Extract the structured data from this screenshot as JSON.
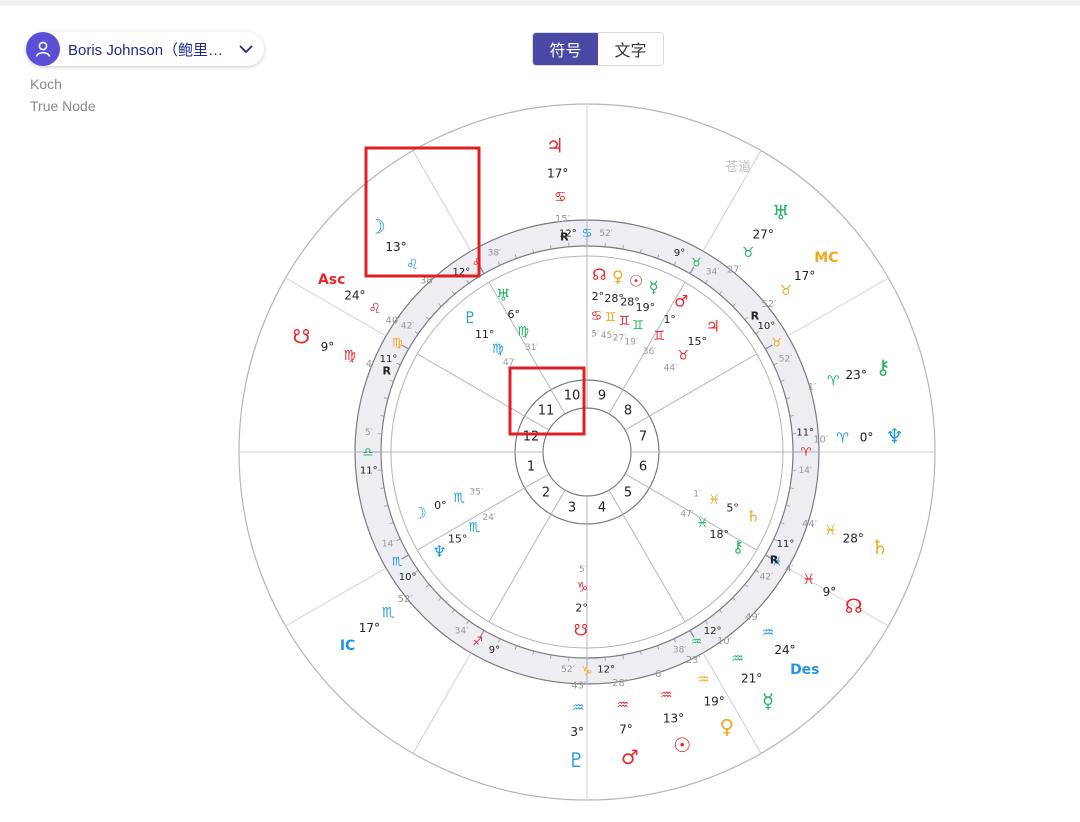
{
  "profile": {
    "name": "Boris Johnson（鲍里…",
    "house_system": "Koch",
    "node_type": "True Node"
  },
  "view_toggle": {
    "symbol_label": "符号",
    "text_label": "文字",
    "active": "symbol"
  },
  "colors": {
    "fire": "#e8272b",
    "earth": "#f0a81c",
    "air": "#21b45a",
    "water": "#2196e6",
    "accent": "#4a4aa6",
    "highlight": "#e02020",
    "ring": "#ededf2",
    "line": "#b4b4bc"
  },
  "chart_data": {
    "type": "astrology-chart",
    "zodiac_labels": {
      "text": "苍道",
      "color": "#c0c0c8"
    },
    "angles": [
      {
        "name": "Asc",
        "color": "#e8272b"
      },
      {
        "name": "MC",
        "color": "#f0a81c"
      },
      {
        "name": "Des",
        "color": "#2196e6"
      },
      {
        "name": "IC",
        "color": "#2196e6"
      }
    ],
    "house_numbers": [
      "1",
      "2",
      "3",
      "4",
      "5",
      "6",
      "7",
      "8",
      "9",
      "10",
      "11",
      "12"
    ],
    "cusps": [
      {
        "deg": "12°",
        "sign": "♋",
        "min": "52′",
        "color": "#2196e6"
      },
      {
        "deg": "9°",
        "sign": "♉",
        "min": "34′",
        "color": "#21b45a"
      },
      {
        "deg": "10°",
        "sign": "♉",
        "min": "52′",
        "color": "#f0a81c"
      },
      {
        "deg": "11°",
        "sign": "♈",
        "min": "14′",
        "color": "#e8272b"
      },
      {
        "deg": "11°",
        "sign": "♓",
        "min": "42′",
        "color": "#2196e6"
      },
      {
        "deg": "12°",
        "sign": "♒",
        "min": "38′",
        "color": "#21b45a"
      },
      {
        "deg": "12°",
        "sign": "♑",
        "min": "52′",
        "color": "#f0a81c"
      },
      {
        "deg": "9°",
        "sign": "♐",
        "min": "34′",
        "color": "#e8272b"
      },
      {
        "deg": "10°",
        "sign": "♏",
        "min": "14′",
        "color": "#2196e6"
      },
      {
        "deg": "11°",
        "sign": "♎",
        "min": "5′",
        "color": "#21b45a"
      },
      {
        "deg": "11°",
        "sign": "♍",
        "min": "42′",
        "color": "#f0a81c"
      },
      {
        "deg": "12°",
        "sign": "♌",
        "min": "38′",
        "color": "#e8272b"
      }
    ],
    "outer_planets": [
      {
        "glyph": "♃",
        "deg": "17°",
        "sign": "♋",
        "min": "15′",
        "retro": "R",
        "color": "#e8272b"
      },
      {
        "glyph": "☽",
        "deg": "13°",
        "sign": "♌",
        "min": "38′",
        "retro": "",
        "color": "#2196e6"
      },
      {
        "glyph": "Asc",
        "deg": "24°",
        "sign": "♌",
        "min": "40′",
        "retro": "",
        "color": "#e8272b"
      },
      {
        "glyph": "☋",
        "deg": "9°",
        "sign": "♍",
        "min": "4′",
        "retro": "R",
        "color": "#e8272b"
      },
      {
        "glyph": "♅",
        "deg": "27°",
        "sign": "♉",
        "min": "27′",
        "retro": "",
        "color": "#21b45a"
      },
      {
        "glyph": "MC",
        "deg": "17°",
        "sign": "♉",
        "min": "52′",
        "retro": "R",
        "color": "#f0a81c"
      },
      {
        "glyph": "⚷",
        "deg": "23°",
        "sign": "♈",
        "min": "1′",
        "retro": "",
        "color": "#21b45a"
      },
      {
        "glyph": "♆",
        "deg": "0°",
        "sign": "♈",
        "min": "10′",
        "retro": "",
        "color": "#2196e6"
      },
      {
        "glyph": "♄",
        "deg": "28°",
        "sign": "♓",
        "min": "44′",
        "retro": "",
        "color": "#f0a81c"
      },
      {
        "glyph": "☊",
        "deg": "9°",
        "sign": "♓",
        "min": "4′",
        "retro": "R",
        "color": "#e8272b"
      },
      {
        "glyph": "Des",
        "deg": "24°",
        "sign": "♒",
        "min": "49′",
        "retro": "",
        "color": "#2196e6"
      },
      {
        "glyph": "☿",
        "deg": "21°",
        "sign": "♒",
        "min": "10′",
        "retro": "",
        "color": "#21b45a"
      },
      {
        "glyph": "♀",
        "deg": "19°",
        "sign": "♒",
        "min": "23′",
        "retro": "",
        "color": "#f0a81c"
      },
      {
        "glyph": "☉",
        "deg": "13°",
        "sign": "♒",
        "min": "6′",
        "retro": "",
        "color": "#e8272b"
      },
      {
        "glyph": "♂",
        "deg": "7°",
        "sign": "♒",
        "min": "28′",
        "retro": "",
        "color": "#e8272b"
      },
      {
        "glyph": "♇",
        "deg": "3°",
        "sign": "♒",
        "min": "43′",
        "retro": "",
        "color": "#2196e6"
      },
      {
        "glyph": "IC",
        "deg": "17°",
        "sign": "♏",
        "min": "52′",
        "retro": "",
        "color": "#2196e6"
      }
    ],
    "inner_planets": [
      {
        "glyph": "☊",
        "deg": "2°",
        "sign": "♋",
        "min": "5′",
        "color": "#e8272b"
      },
      {
        "glyph": "♀",
        "deg": "28°",
        "sign": "♊",
        "min": "45′",
        "color": "#f0a81c"
      },
      {
        "glyph": "☉",
        "deg": "28°",
        "sign": "♊",
        "min": "27′",
        "color": "#e8272b"
      },
      {
        "glyph": "☿",
        "deg": "19°",
        "sign": "♊",
        "min": "19′",
        "color": "#21b45a"
      },
      {
        "glyph": "♂",
        "deg": "1°",
        "sign": "♊",
        "min": "36′",
        "color": "#e8272b"
      },
      {
        "glyph": "♃",
        "deg": "15°",
        "sign": "♉",
        "min": "44′",
        "color": "#e8272b"
      },
      {
        "glyph": "♅",
        "deg": "6°",
        "sign": "♍",
        "min": "31′",
        "color": "#21b45a"
      },
      {
        "glyph": "♇",
        "deg": "11°",
        "sign": "♍",
        "min": "47′",
        "color": "#2196e6"
      },
      {
        "glyph": "☽",
        "deg": "0°",
        "sign": "♏",
        "min": "35′",
        "color": "#2196e6"
      },
      {
        "glyph": "♆",
        "deg": "15°",
        "sign": "♏",
        "min": "24′",
        "color": "#2196e6"
      },
      {
        "glyph": "☋",
        "deg": "2°",
        "sign": "♑",
        "min": "5′",
        "color": "#e8272b"
      },
      {
        "glyph": "⚷",
        "deg": "18°",
        "sign": "♓",
        "min": "47′",
        "color": "#21b45a"
      },
      {
        "glyph": "♄",
        "deg": "5°",
        "sign": "♓",
        "min": "1′",
        "color": "#f0a81c"
      }
    ],
    "retro_labels": [
      "R",
      "R",
      "R",
      "R",
      "R",
      "R",
      "R",
      "R",
      "R"
    ]
  }
}
